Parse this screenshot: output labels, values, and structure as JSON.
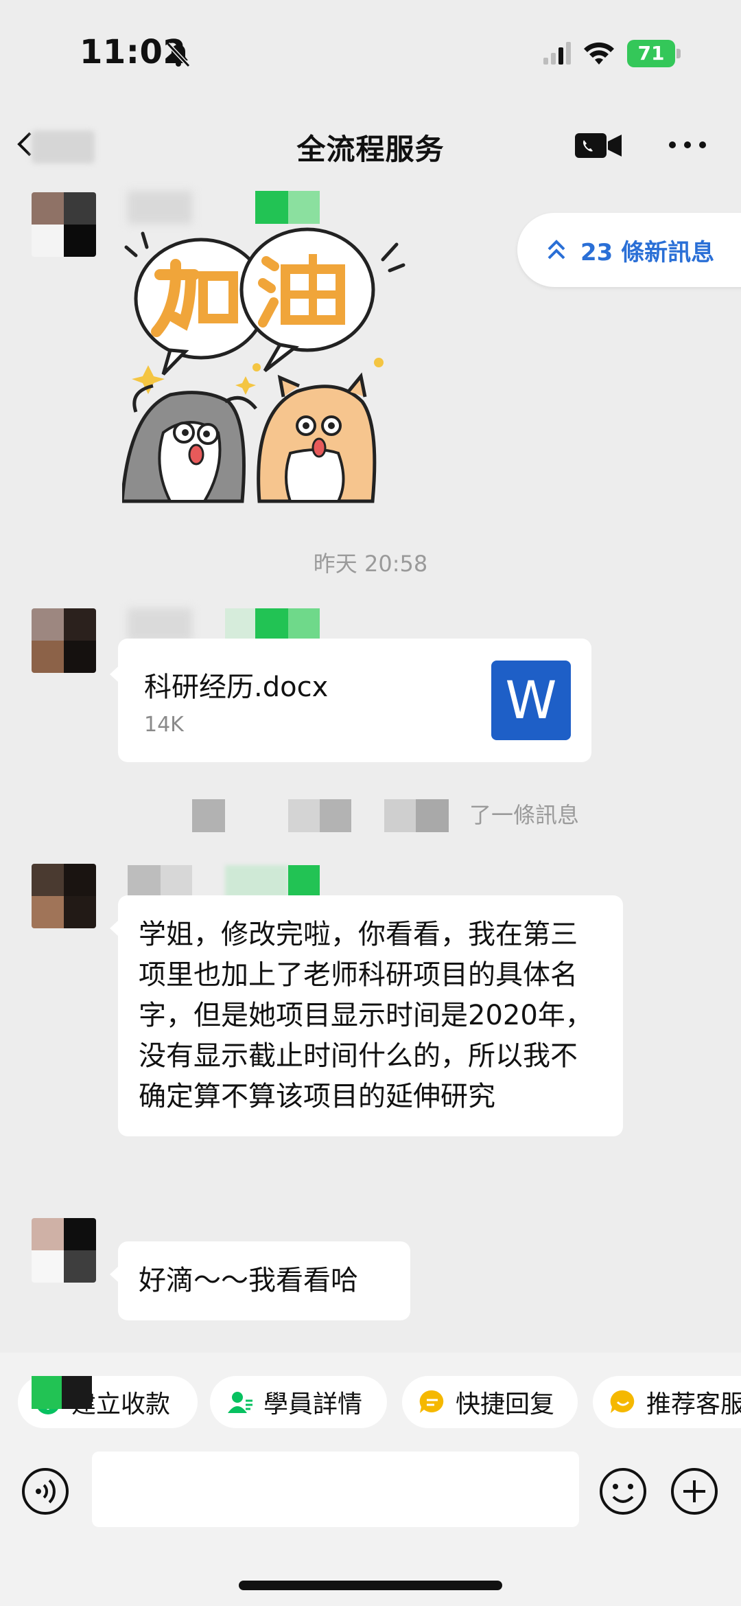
{
  "status_bar": {
    "time": "11:02",
    "battery": "71",
    "icons": [
      "bell-muted-icon",
      "signal-icon",
      "wifi-icon",
      "battery-charging-icon"
    ]
  },
  "nav": {
    "title": "全流程服务",
    "icons": [
      "back-icon",
      "video-call-icon",
      "more-icon"
    ]
  },
  "new_messages": {
    "label": "23 條新訊息",
    "icon": "chevrons-up-icon"
  },
  "messages": {
    "timestamp": "昨天 20:58",
    "file": {
      "name": "科研经历.docx",
      "size": "14K",
      "icon": "word-file-icon",
      "icon_letter": "W"
    },
    "system_note": "了一條訊息",
    "text_1": "学姐，修改完啦，你看看，我在第三项里也加上了老师科研项目的具体名字，但是她项目显示时间是2020年，没有显示截止时间什么的，所以我不确定算不算该项目的延伸研究",
    "text_2": "好滴～～我看看哈"
  },
  "quick_actions": [
    {
      "label": "建立收款",
      "icon": "payment-icon"
    },
    {
      "label": "學員詳情",
      "icon": "student-icon"
    },
    {
      "label": "快捷回复",
      "icon": "quick-reply-icon"
    },
    {
      "label": "推荐客服",
      "icon": "recommend-icon"
    }
  ],
  "input_bar": {
    "placeholder": "",
    "icons": [
      "voice-icon",
      "emoji-icon",
      "plus-icon"
    ]
  },
  "colors": {
    "accent_blue": "#2a6fd6",
    "wechat_green": "#07c160",
    "battery_green": "#34c759",
    "word_blue": "#1e5fc7",
    "chip_yellow": "#f5b800",
    "chat_background": "#ededed"
  }
}
